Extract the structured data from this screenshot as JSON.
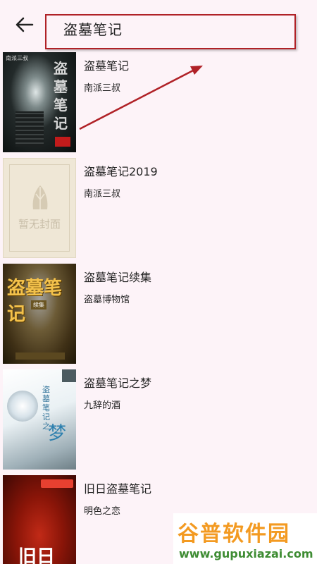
{
  "search": {
    "query": "盗墓笔记"
  },
  "results": [
    {
      "title": "盗墓笔记",
      "author": "南派三叔",
      "cover_text": "盗墓笔记",
      "cover_tag": "南派三叔"
    },
    {
      "title": "盗墓笔记2019",
      "author": "南派三叔",
      "cover_text": "暂无封面"
    },
    {
      "title": "盗墓笔记续集",
      "author": "盗墓博物馆",
      "cover_text": "盗墓笔记",
      "cover_sub": "续集"
    },
    {
      "title": "盗墓笔记之梦",
      "author": "九辞的酒",
      "cover_text": "盗墓笔记之",
      "cover_sub": "梦"
    },
    {
      "title": "旧日盗墓笔记",
      "author": "明色之恋",
      "cover_text": "旧日"
    }
  ],
  "watermark": {
    "line1": "谷普软件园",
    "line2": "www.gupuxiazai.com"
  },
  "colors": {
    "background": "#fdf3f8",
    "annotation": "#b02127"
  }
}
